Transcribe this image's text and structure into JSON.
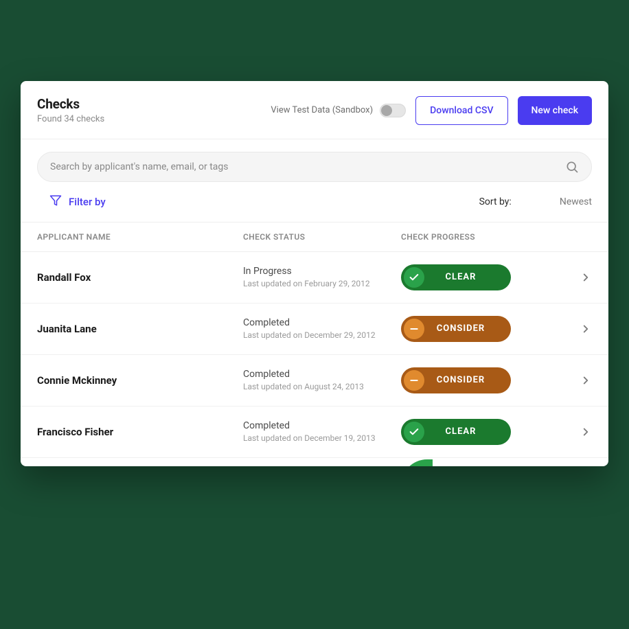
{
  "header": {
    "title": "Checks",
    "subtitle": "Found 34 checks",
    "sandbox_label": "View Test Data (Sandbox)",
    "download_label": "Download CSV",
    "new_check_label": "New check"
  },
  "search": {
    "placeholder": "Search by applicant's name, email, or tags"
  },
  "filter": {
    "label": "Filter by",
    "sort_by_label": "Sort by:",
    "sort_value": "Newest"
  },
  "columns": {
    "name": "APPLICANT NAME",
    "status": "CHECK STATUS",
    "progress": "CHECK PROGRESS"
  },
  "rows": [
    {
      "name": "Randall Fox",
      "status": "In Progress",
      "updated": "Last updated on February 29, 2012",
      "progress_label": "CLEAR",
      "progress_type": "clear"
    },
    {
      "name": "Juanita Lane",
      "status": "Completed",
      "updated": "Last updated on December 29, 2012",
      "progress_label": "CONSIDER",
      "progress_type": "consider"
    },
    {
      "name": "Connie Mckinney",
      "status": "Completed",
      "updated": "Last updated on August 24, 2013",
      "progress_label": "CONSIDER",
      "progress_type": "consider"
    },
    {
      "name": "Francisco Fisher",
      "status": "Completed",
      "updated": "Last updated on December 19, 2013",
      "progress_label": "CLEAR",
      "progress_type": "clear"
    }
  ]
}
